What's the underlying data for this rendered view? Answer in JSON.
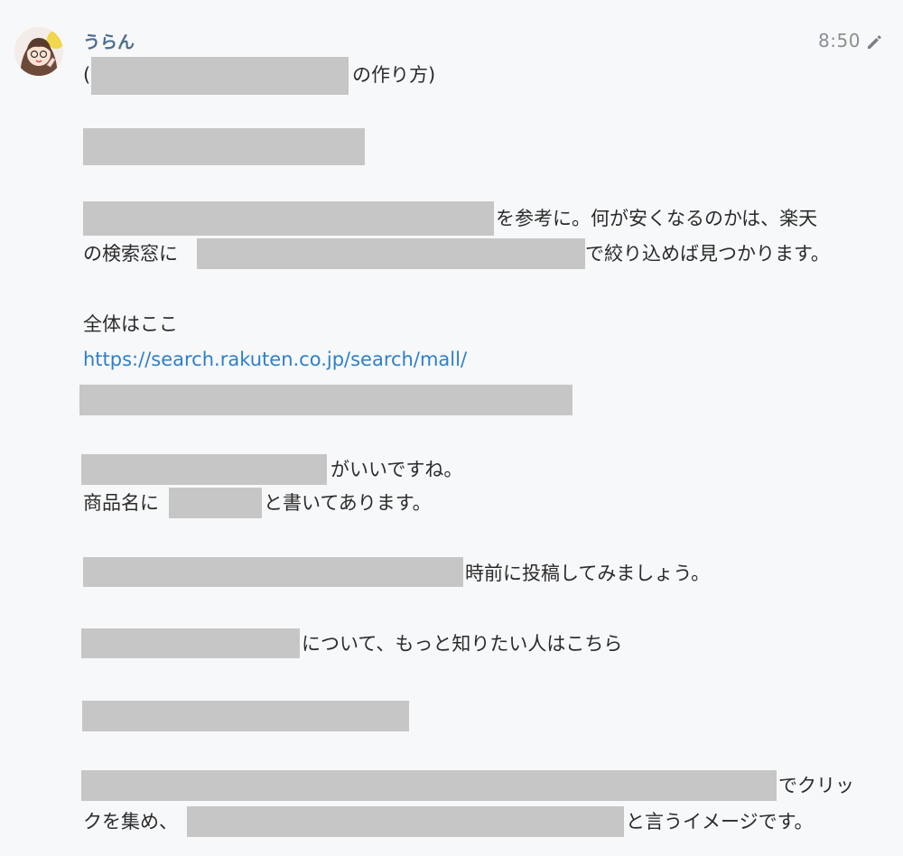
{
  "author": "うらん",
  "timestamp": "8:50",
  "lines": {
    "l1_open": "(",
    "l1_close": "の作り方)",
    "l3_tail": "を参考に。何が安くなるのかは、楽天",
    "l4_head": "の検索窓に",
    "l4_tail": "で絞り込めば見つかります。",
    "l5": "全体はここ",
    "link": "https://search.rakuten.co.jp/search/mall/",
    "l7_tail": "がいいですね。",
    "l8_head": "商品名に",
    "l8_tail": "と書いてあります。",
    "l9_tail": "時前に投稿してみましょう。",
    "l10_tail": "について、もっと知りたい人はこちら",
    "l12_tail": "でクリッ",
    "l13_head": "クを集め、",
    "l13_tail": "と言うイメージです。"
  },
  "icons": {
    "avatar": "avatar-illustration",
    "edit": "pencil-icon"
  }
}
